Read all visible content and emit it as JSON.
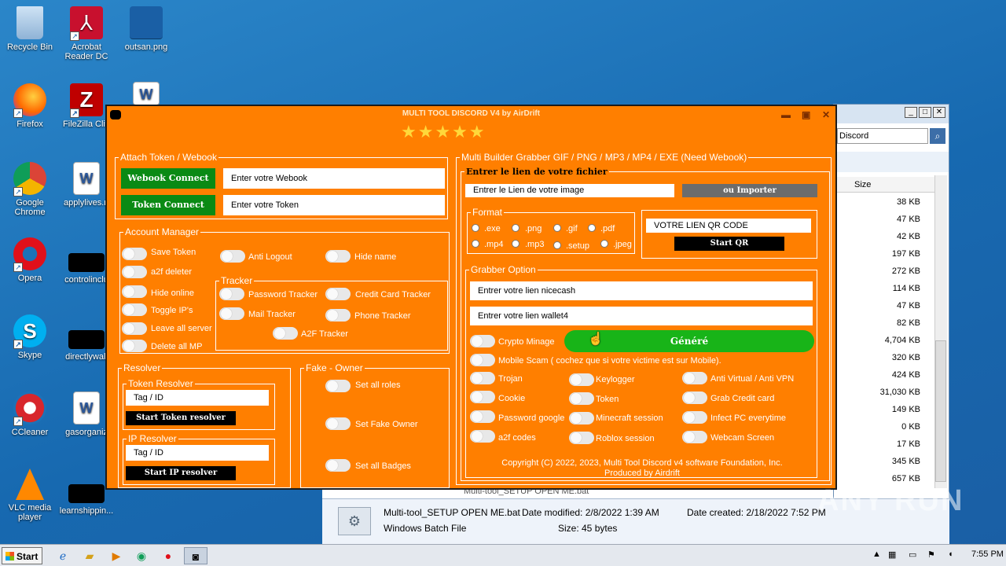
{
  "desktop": {
    "icons": [
      {
        "label": "Recycle Bin",
        "icon": "recycle-bin-icon"
      },
      {
        "label": "Acrobat Reader DC",
        "icon": "acrobat-icon"
      },
      {
        "label": "outsan.png",
        "icon": "image-file-icon"
      },
      {
        "label": "Firefox",
        "icon": "firefox-icon"
      },
      {
        "label": "FileZilla Clie",
        "icon": "filezilla-icon"
      },
      {
        "label": "Google Chrome",
        "icon": "chrome-icon"
      },
      {
        "label": "applylives.rt",
        "icon": "word-doc-icon"
      },
      {
        "label": "Opera",
        "icon": "opera-icon"
      },
      {
        "label": "controlinclu",
        "icon": "file-icon"
      },
      {
        "label": "Skype",
        "icon": "skype-icon"
      },
      {
        "label": "directlywall",
        "icon": "file-icon"
      },
      {
        "label": "CCleaner",
        "icon": "ccleaner-icon"
      },
      {
        "label": "gasorganiz",
        "icon": "word-doc-icon"
      },
      {
        "label": "VLC media player",
        "icon": "vlc-icon"
      },
      {
        "label": "learnshippin...",
        "icon": "file-icon"
      }
    ]
  },
  "explorer": {
    "address": "Discord",
    "column_size": "Size",
    "sizes": [
      "38 KB",
      "47 KB",
      "42 KB",
      "197 KB",
      "272 KB",
      "114 KB",
      "47 KB",
      "82 KB",
      "4,704 KB",
      "320 KB",
      "424 KB",
      "31,030 KB",
      "149 KB",
      "0 KB",
      "17 KB",
      "345 KB",
      "657 KB"
    ],
    "partial_row": "Multi-tool_SETUP OPEN ME.bat",
    "details": {
      "filename": "Multi-tool_SETUP OPEN ME.bat",
      "type": "Windows Batch File",
      "date_modified": "Date modified: 2/8/2022 1:39 AM",
      "size": "Size: 45 bytes",
      "date_created": "Date created: 2/18/2022 7:52 PM"
    }
  },
  "tool": {
    "title": "MULTI TOOL DISCORD V4 by AirDrift",
    "stars": "★★★★★",
    "attach": {
      "legend": "Attach Token / Webook",
      "webook_btn": "Webook Connect",
      "webook_input": "Enter votre Webook",
      "token_btn": "Token Connect",
      "token_input": "Enter votre Token"
    },
    "account": {
      "legend": "Account Manager",
      "col1": [
        "Save Token",
        "a2f deleter",
        "Hide online",
        "Toggle IP's",
        "Leave all server",
        "Delete all MP"
      ],
      "anti_logout": "Anti Logout",
      "hide_name": "Hide name",
      "tracker_legend": "Tracker",
      "tracker": [
        "Password Tracker",
        "Credit Card Tracker",
        "Mail Tracker",
        "Phone Tracker",
        "A2F Tracker"
      ]
    },
    "resolver": {
      "legend": "Resolver",
      "token_legend": "Token Resolver",
      "token_input": "Tag / ID",
      "token_btn": "Start Token resolver",
      "ip_legend": "IP Resolver",
      "ip_input": "Tag / ID",
      "ip_btn": "Start IP resolver"
    },
    "fake_owner": {
      "legend": "Fake - Owner",
      "items": [
        "Set all roles",
        "Set Fake Owner",
        "Set all Badges"
      ]
    },
    "builder": {
      "legend": "Multi Builder Grabber GIF / PNG / MP3 / MP4 / EXE (Need Webook)",
      "file_legend": "Entrer le lien de votre fichier",
      "image_input": "Entrer le Lien de votre image",
      "import_btn": "ou Importer",
      "format_legend": "Format",
      "formats": [
        ".exe",
        ".png",
        ".gif",
        ".pdf",
        ".mp4",
        ".mp3",
        ".setup",
        ".jpeg"
      ],
      "qr_input": "VOTRE LIEN QR CODE",
      "qr_btn": "Start QR",
      "grabber_legend": "Grabber Option",
      "nicecash_input": "Entrer  votre lien nicecash",
      "wallet_input": "Entrer votre lien wallet4",
      "crypto": "Crypto Minage",
      "generate_btn": "Généré",
      "mobile": "Mobile Scam ( cochez que si votre victime est sur Mobile).",
      "col1": [
        "Trojan",
        "Cookie",
        "Password google",
        "a2f codes"
      ],
      "col2": [
        "Keylogger",
        "Token",
        "Minecraft session",
        "Roblox session"
      ],
      "col3": [
        "Anti Virtual / Anti VPN",
        "Grab Credit card",
        "Infect PC everytime",
        "Webcam Screen"
      ],
      "copyright": "Copyright (C) 2022, 2023, Multi Tool Discord v4 software Foundation, Inc.",
      "produced": "Produced by Airdrift"
    }
  },
  "taskbar": {
    "start": "Start",
    "clock": "7:55 PM"
  },
  "watermark": "ANY RUN"
}
